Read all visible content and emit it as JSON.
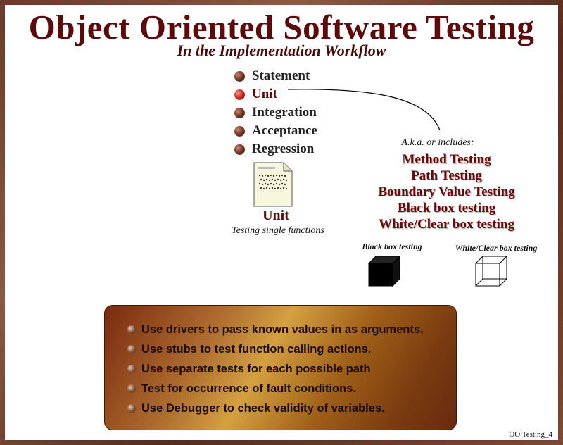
{
  "title": "Object Oriented Software Testing",
  "subtitle": "In the Implementation Workflow",
  "levels": [
    {
      "label": "Statement",
      "active": false
    },
    {
      "label": "Unit",
      "active": true
    },
    {
      "label": "Integration",
      "active": false
    },
    {
      "label": "Acceptance",
      "active": false
    },
    {
      "label": "Regression",
      "active": false
    }
  ],
  "unit": {
    "caption": "Unit",
    "description": "Testing single functions"
  },
  "aka": {
    "heading": "A.k.a. or includes:",
    "items": [
      "Method Testing",
      "Path Testing",
      "Boundary Value Testing",
      "Black box testing",
      "White/Clear box testing"
    ]
  },
  "boxes": {
    "black_label": "Black box testing",
    "white_label": "White/Clear box testing"
  },
  "tips": [
    "Use drivers to pass known values in as arguments.",
    "Use stubs to test function calling actions.",
    "Use separate tests for each possible path",
    "Test for occurrence of fault conditions.",
    "Use Debugger to check validity of variables."
  ],
  "footer": "OO Testing_4",
  "colors": {
    "title": "#5c0a0a",
    "accent": "#6a0808",
    "frame": "#6b3a2a"
  }
}
